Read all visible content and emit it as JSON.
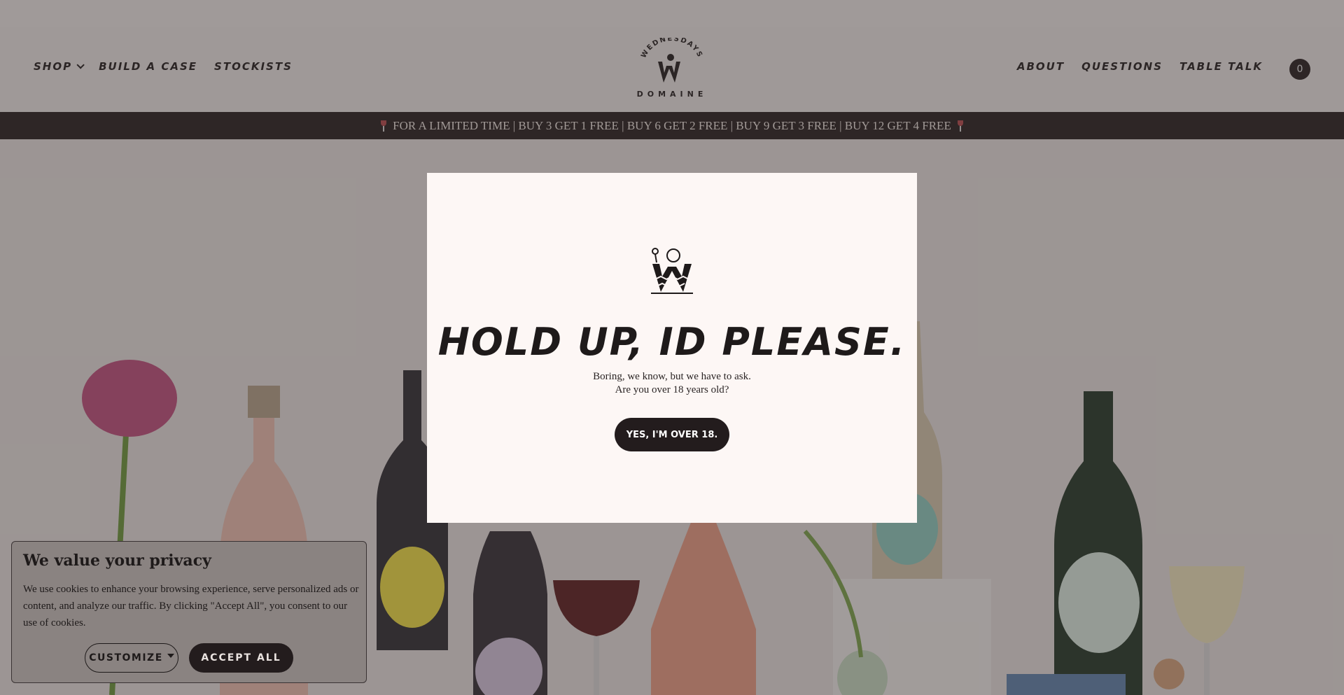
{
  "header": {
    "nav_left": [
      "SHOP",
      "BUILD A CASE",
      "STOCKISTS"
    ],
    "nav_right": [
      "ABOUT",
      "QUESTIONS",
      "TABLE TALK"
    ],
    "logo_text_top": "WEDNESDAYS",
    "logo_text_bottom": "DOMAINE",
    "cart_count": "0"
  },
  "promo": {
    "text": "FOR A LIMITED TIME | BUY 3 GET 1 FREE | BUY 6 GET 2 FREE | BUY 9 GET 3 FREE | BUY 12 GET 4 FREE"
  },
  "modal": {
    "title": "HOLD UP, ID PLEASE.",
    "line1": "Boring, we know, but we have to ask.",
    "line2": "Are you over 18 years old?",
    "button": "YES, I'M OVER 18."
  },
  "cookie": {
    "title": "We value your privacy",
    "text": "We use cookies to enhance your browsing experience, serve personalized ads or content, and analyze our traffic. By clicking \"Accept All\", you consent to our use of cookies.",
    "customize": "CUSTOMIZE",
    "accept": "ACCEPT ALL"
  },
  "colors": {
    "dark": "#231c1d",
    "modal_bg": "#fdf7f5",
    "header_bg": "#f1edeb"
  }
}
